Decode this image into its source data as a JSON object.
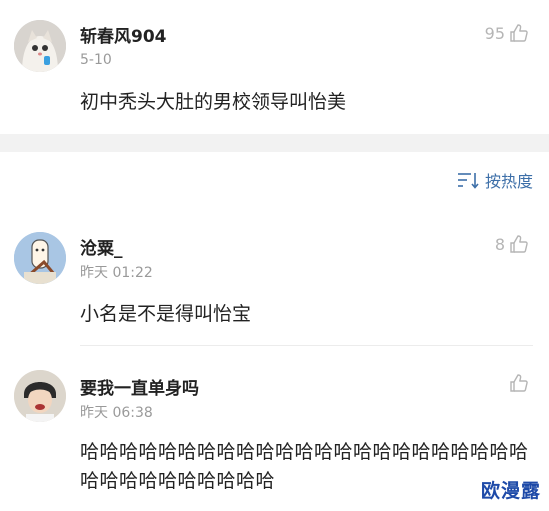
{
  "top_comment": {
    "username": "斩春风904",
    "date": "5-10",
    "likes": "95",
    "text": "初中秃头大肚的男校领导叫怡美"
  },
  "sort": {
    "label": "按热度"
  },
  "comments": [
    {
      "username": "沧粟_",
      "time": "昨天 01:22",
      "likes": "8",
      "text": "小名是不是得叫怡宝"
    },
    {
      "username": "要我一直单身吗",
      "time": "昨天 06:38",
      "likes": "",
      "text": "哈哈哈哈哈哈哈哈哈哈哈哈哈哈哈哈哈哈哈哈哈哈哈哈哈哈哈哈哈哈哈哈哈"
    }
  ],
  "watermark": "欧漫露"
}
